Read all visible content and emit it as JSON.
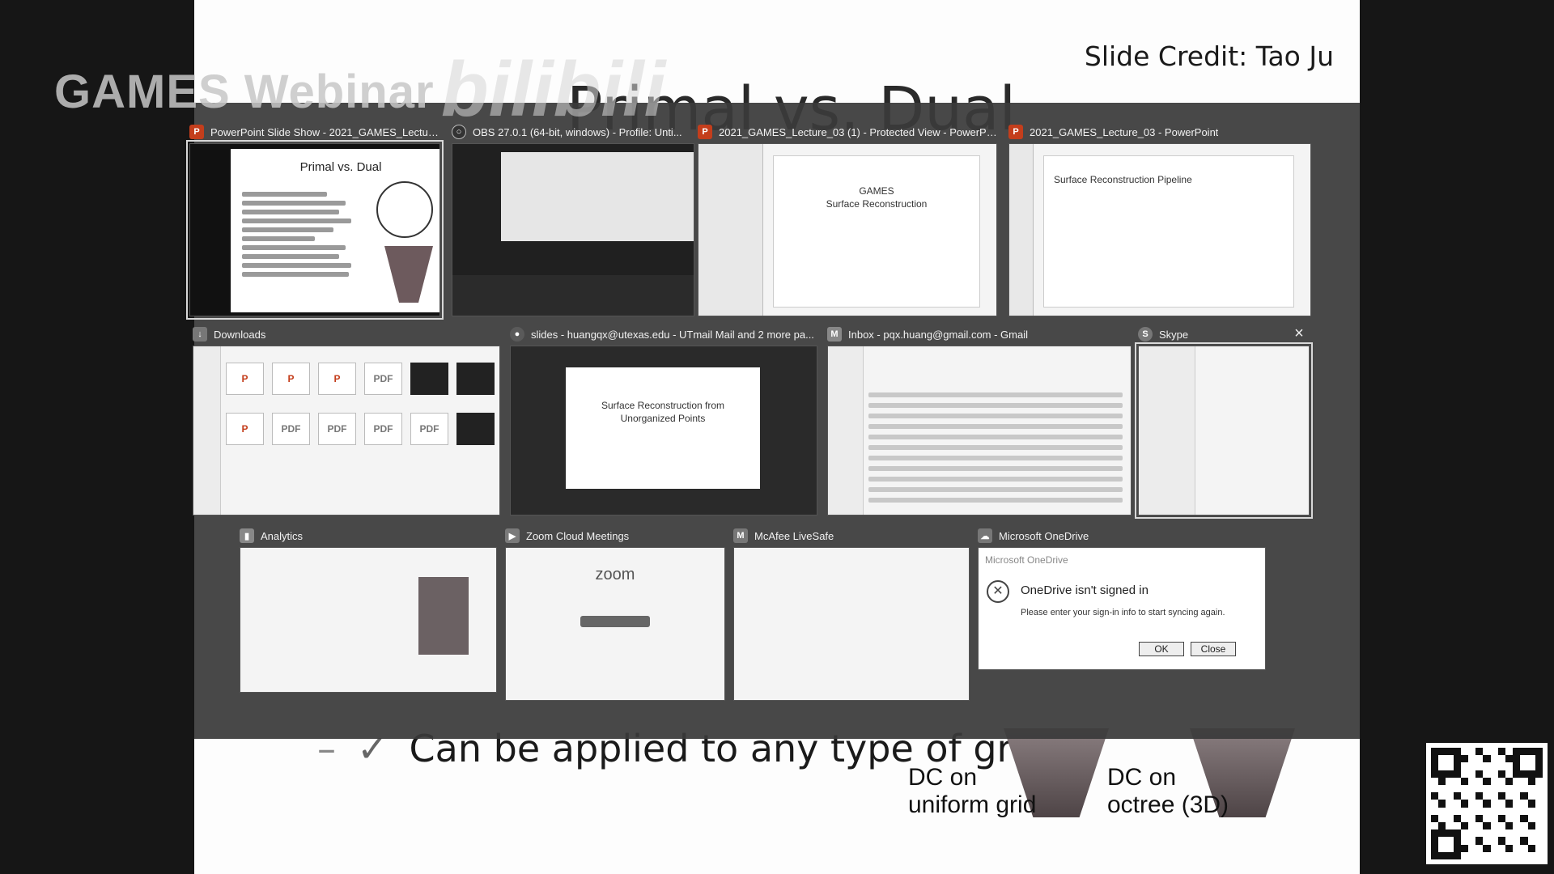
{
  "watermark": {
    "channel": "GAMES Webinar",
    "logo": "bilibili"
  },
  "slide": {
    "credit": "Slide Credit: Tao Ju",
    "title": "Primal vs. Dual",
    "bullet_bottom": "Can be applied to any type of gric",
    "bullet_dash": "–",
    "bullet_check": "✓",
    "figure_label_1": "DC on\nuniform grid",
    "figure_label_2": "DC on\noctree (3D)"
  },
  "windows": [
    {
      "title": "PowerPoint Slide Show - 2021_GAMES_Lecture_03 (1)...",
      "icon": "powerpoint-icon",
      "selected": true,
      "thumb_title": "Primal vs. Dual"
    },
    {
      "title": "OBS 27.0.1 (64-bit, windows) - Profile: Unti...",
      "icon": "obs-icon"
    },
    {
      "title": "2021_GAMES_Lecture_03 (1) - Protected View - PowerPoi...",
      "icon": "powerpoint-icon",
      "thumb_line1": "GAMES",
      "thumb_line2": "Surface Reconstruction"
    },
    {
      "title": "2021_GAMES_Lecture_03 - PowerPoint",
      "icon": "powerpoint-icon",
      "thumb_line1": "Surface Reconstruction Pipeline"
    },
    {
      "title": "Downloads",
      "icon": "folder-icon"
    },
    {
      "title": "slides - huangqx@utexas.edu - UTmail Mail and 2 more pa...",
      "icon": "chrome-icon",
      "thumb_line1": "Surface Reconstruction from",
      "thumb_line2": "Unorganized Points"
    },
    {
      "title": "Inbox - pqx.huang@gmail.com - Gmail",
      "icon": "gmail-icon"
    },
    {
      "title": "Skype",
      "icon": "skype-icon"
    },
    {
      "title": "Analytics",
      "icon": "analytics-icon"
    },
    {
      "title": "Zoom Cloud Meetings",
      "icon": "zoom-icon",
      "thumb_line1": "zoom"
    },
    {
      "title": "McAfee LiveSafe",
      "icon": "mcafee-icon"
    },
    {
      "title": "Microsoft OneDrive",
      "icon": "onedrive-icon"
    }
  ],
  "onedrive": {
    "header": "Microsoft OneDrive",
    "message": "OneDrive isn't signed in",
    "sub": "Please enter your sign-in info to start syncing again.",
    "ok": "OK",
    "close": "Close"
  },
  "downloads": {
    "files": [
      "P",
      "P",
      "P",
      "PDF",
      "",
      "",
      "P",
      "PDF",
      "PDF",
      "PDF",
      "PDF",
      ""
    ]
  },
  "icons": {
    "close": "×"
  },
  "colors": {
    "taskview_bg": "#3a3a3a",
    "slide_bg": "#fdfdfd",
    "outer_bg": "#161616"
  }
}
